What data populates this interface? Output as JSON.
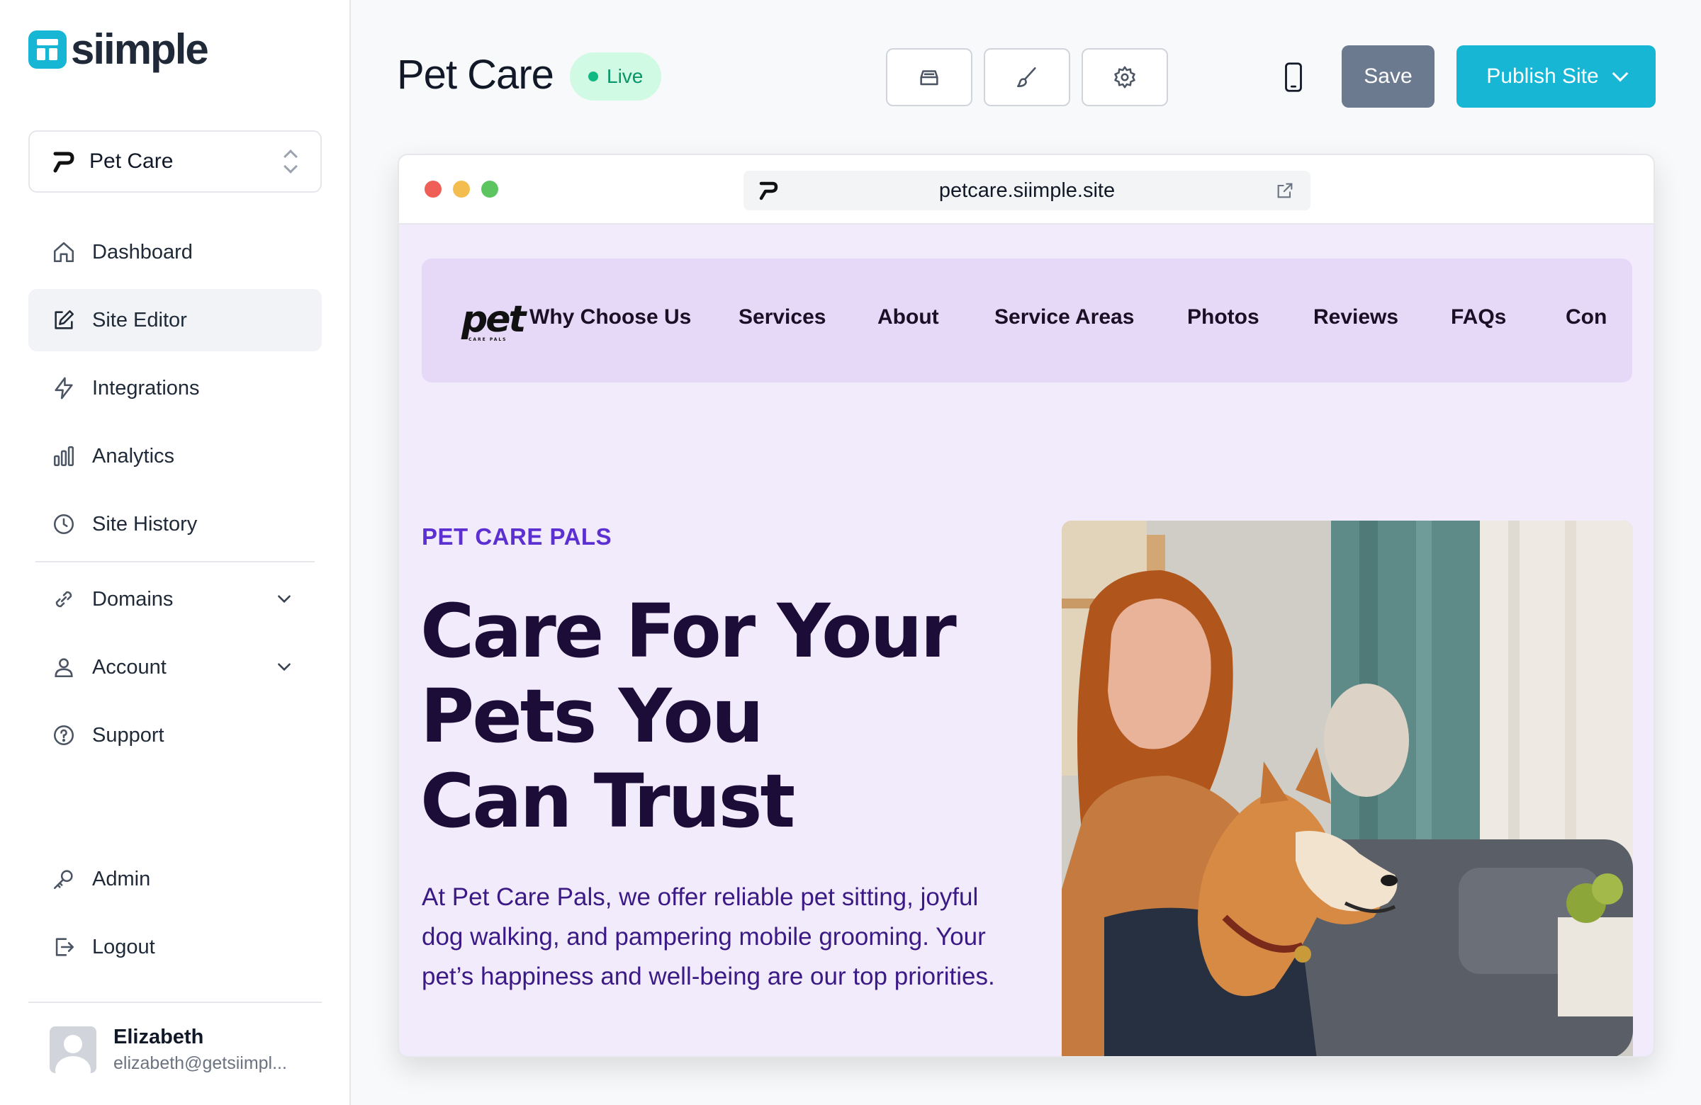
{
  "app": {
    "name": "siimple"
  },
  "sidebar": {
    "site_selector": {
      "value": "Pet Care"
    },
    "items": [
      {
        "label": "Dashboard",
        "icon": "home-icon"
      },
      {
        "label": "Site Editor",
        "icon": "edit-icon",
        "active": true
      },
      {
        "label": "Integrations",
        "icon": "bolt-icon"
      },
      {
        "label": "Analytics",
        "icon": "bar-chart-icon"
      },
      {
        "label": "Site History",
        "icon": "clock-icon"
      },
      {
        "label": "Domains",
        "icon": "link-icon"
      },
      {
        "label": "Account",
        "icon": "user-icon"
      },
      {
        "label": "Support",
        "icon": "help-icon"
      },
      {
        "label": "Admin",
        "icon": "key-icon"
      },
      {
        "label": "Logout",
        "icon": "logout-icon"
      }
    ],
    "user": {
      "name": "Elizabeth",
      "email": "elizabeth@getsiimpl..."
    }
  },
  "header": {
    "title": "Pet Care",
    "status": "Live",
    "tools": [
      "layers-icon",
      "brush-icon",
      "settings-icon"
    ],
    "device_icon": "mobile-icon",
    "save_label": "Save",
    "publish_label": "Publish Site"
  },
  "preview": {
    "url": "petcare.siimple.site",
    "site": {
      "logo_text": "pet",
      "logo_subtext": "CARE PALS",
      "nav": [
        "Why Choose Us",
        "Services",
        "About",
        "Service Areas",
        "Photos",
        "Reviews",
        "FAQs",
        "Con"
      ],
      "eyebrow": "PET CARE PALS",
      "hero_title": [
        "Care For Your",
        "Pets You",
        "Can Trust"
      ],
      "hero_body": "At Pet Care Pals, we offer reliable pet sitting, joyful dog walking, and pampering mobile grooming. Your pet’s happiness and well-being are our top priorities."
    }
  },
  "colors": {
    "accent": "#16b6d4",
    "live_bg": "#d1fae5",
    "live_text": "#059669",
    "site_bg": "#f1ebfb",
    "site_nav_bg": "#e6d9f8",
    "eyebrow": "#5b2fd1",
    "hero_title": "#1c0c38"
  }
}
